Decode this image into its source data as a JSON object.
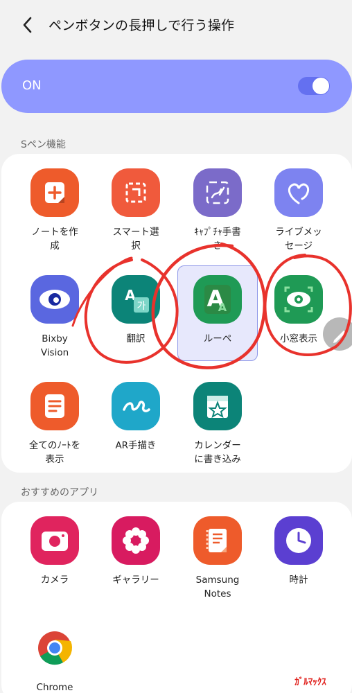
{
  "header": {
    "title": "ペンボタンの長押しで行う操作"
  },
  "master_switch": {
    "label": "ON",
    "state": "on"
  },
  "sections": {
    "s_pen": "Sペン機能",
    "recommended": "おすすめのアプリ"
  },
  "s_pen_apps": [
    {
      "label_lines": [
        "ノートを作",
        "成"
      ],
      "icon": "create-note-icon",
      "color": "#ee5b2b"
    },
    {
      "label_lines": [
        "スマート選",
        "択"
      ],
      "icon": "smart-select-icon",
      "color": "#f05a3c"
    },
    {
      "label_lines": [
        "ｷｬﾌﾟﾁｬ手書",
        "き"
      ],
      "icon": "screen-write-icon",
      "color": "#7b6bc9"
    },
    {
      "label_lines": [
        "ライブメッ",
        "セージ"
      ],
      "icon": "live-message-icon",
      "color": "#7d83f0"
    },
    {
      "label_lines": [
        "Bixby",
        "Vision"
      ],
      "icon": "bixby-vision-icon",
      "color": "#5a67e0"
    },
    {
      "label_lines": [
        "翻訳"
      ],
      "icon": "translate-icon",
      "color": "#0c8478"
    },
    {
      "label_lines": [
        "ルーペ"
      ],
      "icon": "magnify-icon",
      "color": "#1f9a55"
    },
    {
      "label_lines": [
        "小窓表示"
      ],
      "icon": "glance-icon",
      "color": "#1f9a55"
    },
    {
      "label_lines": [
        "全てのﾉｰﾄを",
        "表示"
      ],
      "icon": "view-all-notes-icon",
      "color": "#ee5b2b"
    },
    {
      "label_lines": [
        "AR手描き"
      ],
      "icon": "ar-doodle-icon",
      "color": "#1fa7c9"
    },
    {
      "label_lines": [
        "カレンダー",
        "に書き込み"
      ],
      "icon": "calendar-write-icon",
      "color": "#0c8478"
    }
  ],
  "recommended_apps": [
    {
      "label_lines": [
        "カメラ"
      ],
      "icon": "camera-icon",
      "color": "#e0245e"
    },
    {
      "label_lines": [
        "ギャラリー"
      ],
      "icon": "gallery-icon",
      "color": "#d81b60"
    },
    {
      "label_lines": [
        "Samsung",
        "Notes"
      ],
      "icon": "samsung-notes-icon",
      "color": "#ee5b2b"
    },
    {
      "label_lines": [
        "時計"
      ],
      "icon": "clock-icon",
      "color": "#5b3fd1"
    },
    {
      "label_lines": [
        "Chrome"
      ],
      "icon": "chrome-icon",
      "color": "#ffffff"
    }
  ]
}
